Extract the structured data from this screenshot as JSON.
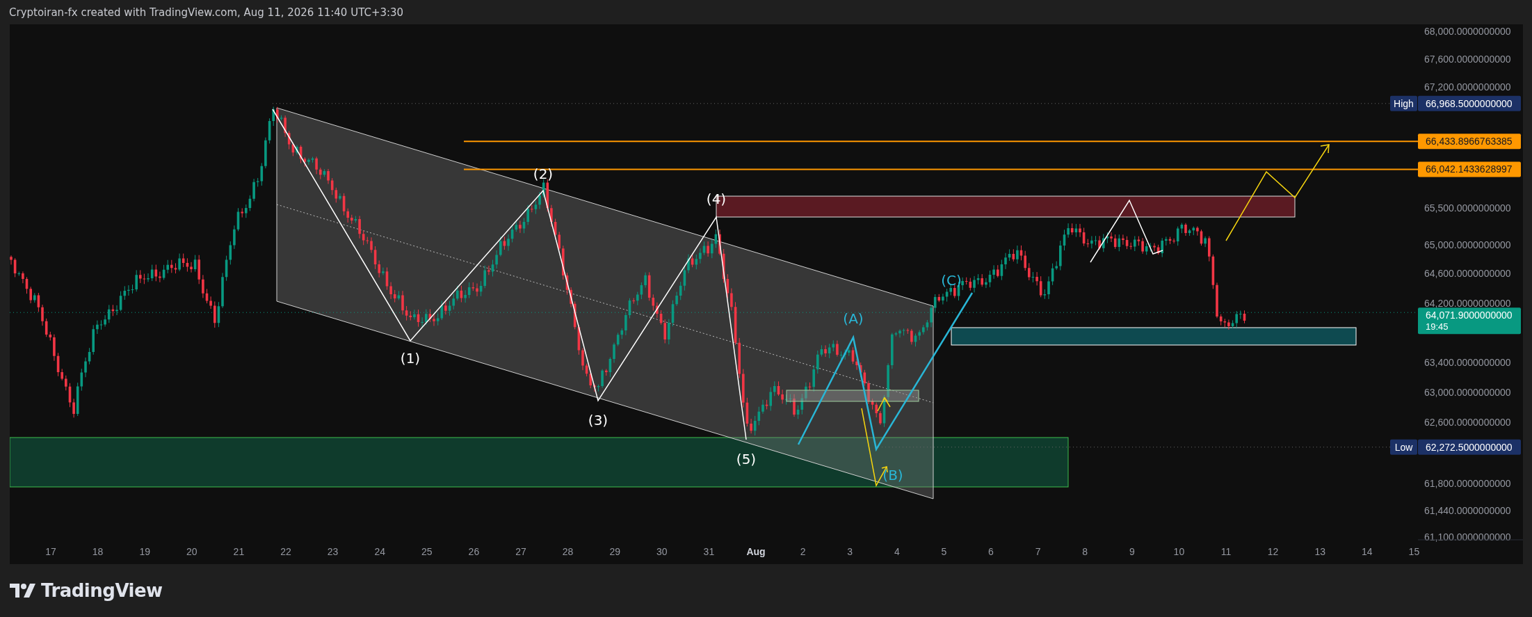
{
  "header": {
    "text": "Cryptoiran-fx created with TradingView.com, Aug 11, 2026 11:40 UTC+3:30"
  },
  "chart": {
    "price_axis": [
      "68,000.0000000000",
      "67,600.0000000000",
      "67,200.0000000000",
      "65,500.0000000000",
      "65,000.0000000000",
      "64,600.0000000000",
      "64,200.0000000000",
      "63,400.0000000000",
      "63,000.0000000000",
      "62,600.0000000000",
      "61,800.0000000000",
      "61,440.0000000000",
      "61,100.0000000000"
    ],
    "time_axis": [
      {
        "label": "17",
        "kind": "day"
      },
      {
        "label": "18",
        "kind": "day"
      },
      {
        "label": "19",
        "kind": "day"
      },
      {
        "label": "20",
        "kind": "day"
      },
      {
        "label": "21",
        "kind": "day"
      },
      {
        "label": "22",
        "kind": "day"
      },
      {
        "label": "23",
        "kind": "day"
      },
      {
        "label": "24",
        "kind": "day"
      },
      {
        "label": "25",
        "kind": "day"
      },
      {
        "label": "26",
        "kind": "day"
      },
      {
        "label": "27",
        "kind": "day"
      },
      {
        "label": "28",
        "kind": "day"
      },
      {
        "label": "29",
        "kind": "day"
      },
      {
        "label": "30",
        "kind": "day"
      },
      {
        "label": "31",
        "kind": "day"
      },
      {
        "label": "Aug",
        "kind": "month"
      },
      {
        "label": "2",
        "kind": "day"
      },
      {
        "label": "3",
        "kind": "day"
      },
      {
        "label": "4",
        "kind": "day"
      },
      {
        "label": "5",
        "kind": "day"
      },
      {
        "label": "6",
        "kind": "day"
      },
      {
        "label": "7",
        "kind": "day"
      },
      {
        "label": "8",
        "kind": "day"
      },
      {
        "label": "9",
        "kind": "day"
      },
      {
        "label": "10",
        "kind": "day"
      },
      {
        "label": "11",
        "kind": "day"
      },
      {
        "label": "12",
        "kind": "day"
      },
      {
        "label": "13",
        "kind": "day"
      },
      {
        "label": "14",
        "kind": "day"
      },
      {
        "label": "15",
        "kind": "day"
      }
    ],
    "price_tags": [
      {
        "kind": "high",
        "label": "High",
        "value": "66,968.5000000000"
      },
      {
        "kind": "level",
        "value": "66,433.8966763385"
      },
      {
        "kind": "level",
        "value": "66,042.1433628997"
      },
      {
        "kind": "last",
        "value": "64,071.9000000000",
        "countdown": "19:45"
      },
      {
        "kind": "low",
        "label": "Low",
        "value": "62,272.5000000000"
      }
    ],
    "wave_labels": [
      {
        "text": "(1)",
        "kind": "impulse"
      },
      {
        "text": "(2)",
        "kind": "impulse"
      },
      {
        "text": "(3)",
        "kind": "impulse"
      },
      {
        "text": "(4)",
        "kind": "impulse"
      },
      {
        "text": "(5)",
        "kind": "impulse"
      },
      {
        "text": "(A)",
        "kind": "corrective"
      },
      {
        "text": "(B)",
        "kind": "corrective"
      },
      {
        "text": "(C)",
        "kind": "corrective"
      }
    ]
  },
  "footer": {
    "logo_text": "TradingView"
  }
}
